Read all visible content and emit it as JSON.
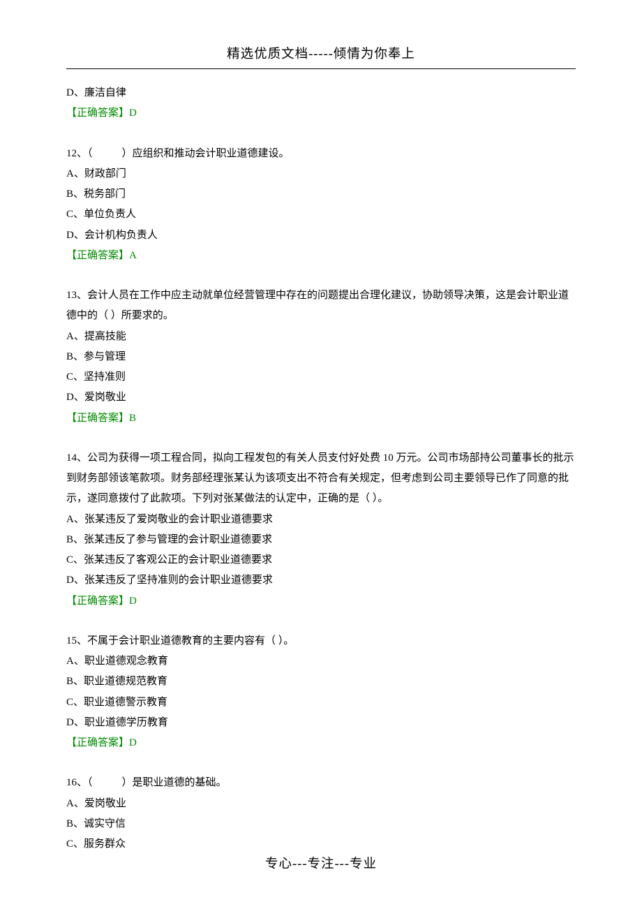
{
  "header_title": "精选优质文档-----倾情为你奉上",
  "footer_text": "专心---专注---专业",
  "answer_label_prefix": "【正确答案】",
  "items": {
    "q11_tail_option": "D、廉洁自律",
    "q11_answer": "D",
    "q12_stem_prefix": "12、（",
    "q12_stem_suffix": "）应组织和推动会计职业道德建设。",
    "q12_a": "A、财政部门",
    "q12_b": "B、税务部门",
    "q12_c": "C、单位负责人",
    "q12_d": "D、会计机构负责人",
    "q12_answer": "A",
    "q13_stem": "13、会计人员在工作中应主动就单位经营管理中存在的问题提出合理化建议，协助领导决策，这是会计职业道德中的（  ）所要求的。",
    "q13_a": "A、提高技能",
    "q13_b": "B、参与管理",
    "q13_c": "C、坚持准则",
    "q13_d": "D、爱岗敬业",
    "q13_answer": "B",
    "q14_stem": "14、公司为获得一项工程合同，拟向工程发包的有关人员支付好处费 10 万元。公司市场部持公司董事长的批示到财务部领该笔款项。财务部经理张某认为该项支出不符合有关规定，但考虑到公司主要领导已作了同意的批示，遂同意拨付了此款项。下列对张某做法的认定中，正确的是（  ）。",
    "q14_a": "A、张某违反了爱岗敬业的会计职业道德要求",
    "q14_b": "B、张某违反了参与管理的会计职业道德要求",
    "q14_c": "C、张某违反了客观公正的会计职业道德要求",
    "q14_d": "D、张某违反了坚持准则的会计职业道德要求",
    "q14_answer": "D",
    "q15_stem": "15、不属于会计职业道德教育的主要内容有（  ）。",
    "q15_a": "A、职业道德观念教育",
    "q15_b": "B、职业道德规范教育",
    "q15_c": "C、职业道德警示教育",
    "q15_d": "D、职业道德学历教育",
    "q15_answer": "D",
    "q16_stem_prefix": "16、（",
    "q16_stem_suffix": "）是职业道德的基础。",
    "q16_a": "A、爱岗敬业",
    "q16_b": "B、诚实守信",
    "q16_c": "C、服务群众"
  }
}
